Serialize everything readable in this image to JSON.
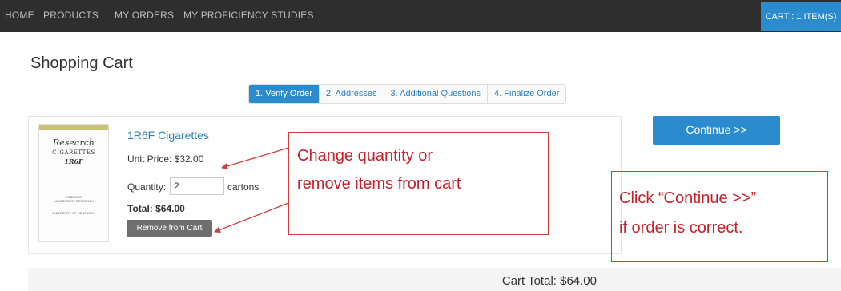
{
  "nav": {
    "items": [
      "HOME",
      "PRODUCTS",
      "MY ORDERS",
      "MY PROFICIENCY STUDIES"
    ],
    "cart_label": "CART : 1 ITEM(S)"
  },
  "page": {
    "title": "Shopping Cart"
  },
  "steps": [
    "1. Verify Order",
    "2. Addresses",
    "3. Additional Questions",
    "4. Finalize Order"
  ],
  "product": {
    "name": "1R6F Cigarettes",
    "unit_price": "Unit Price: $32.00",
    "quantity_label": "Quantity:",
    "quantity_value": "2",
    "quantity_unit": "cartons",
    "total": "Total: $64.00",
    "remove_label": "Remove from Cart",
    "image_text": {
      "research": "Research",
      "cigarettes": "CIGARETTES",
      "code": "1R6F",
      "lab": "TOBACCO\nLABORATORY RESEARCH",
      "univ": "UNIVERSITY OF KENTUCKY"
    }
  },
  "continue_label": "Continue >>",
  "cart_total": "Cart Total: $64.00",
  "annotations": {
    "left_line1": "Change quantity or",
    "left_line2": "remove items from cart",
    "right_line1": "Click “Continue >>”",
    "right_line2": "if order is correct."
  },
  "colors": {
    "accent": "#2a8ccf",
    "annotation": "#d43c3c",
    "nav_bg": "#2e2e2e"
  }
}
